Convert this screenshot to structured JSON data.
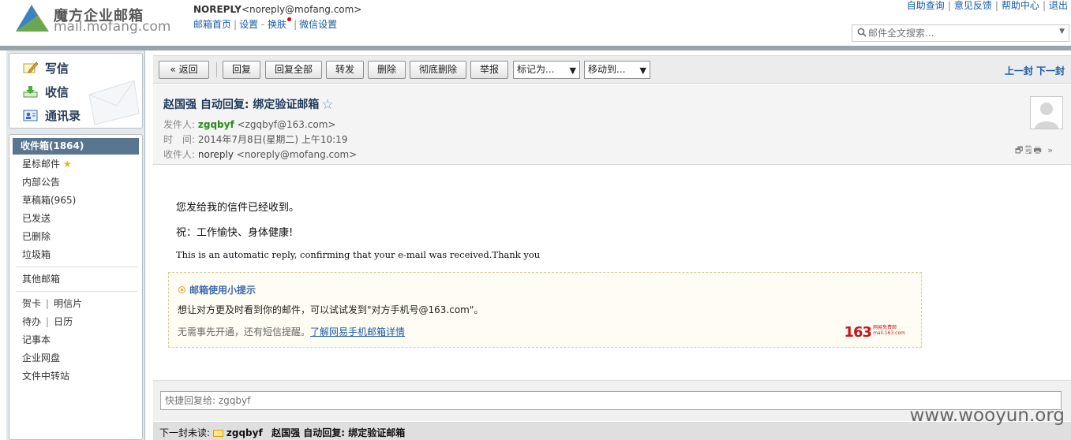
{
  "header": {
    "logo_title": "魔方企业邮箱",
    "logo_domain": "mail.mofang.com",
    "user_name": "NOREPLY",
    "user_email": "<noreply@mofang.com>",
    "links": {
      "home": "邮箱首页",
      "settings": "设置",
      "skin": "换肤",
      "wechat": "微信设置"
    },
    "top_links": [
      "自助查询",
      "意见反馈",
      "帮助中心",
      "退出"
    ],
    "search_placeholder": "邮件全文搜索..."
  },
  "sidebar": {
    "quick": {
      "compose": "写信",
      "inbox": "收信",
      "contacts": "通讯录"
    },
    "folders": {
      "inbox": "收件箱(1864)",
      "starred": "星标邮件",
      "notice": "内部公告",
      "drafts": "草稿箱(965)",
      "sent": "已发送",
      "deleted": "已删除",
      "spam": "垃圾箱",
      "other": "其他邮箱",
      "card": "贺卡",
      "postcard": "明信片",
      "todo": "待办",
      "calendar": "日历",
      "notepad": "记事本",
      "netdisk": "企业网盘",
      "transfer": "文件中转站"
    }
  },
  "toolbar": {
    "back": "« 返回",
    "reply": "回复",
    "reply_all": "回复全部",
    "forward": "转发",
    "delete": "删除",
    "delete_permanent": "彻底删除",
    "report": "举报",
    "mark_as": "标记为...",
    "move_to": "移动到...",
    "prev_next": "上一封 下一封"
  },
  "mail": {
    "subject": "赵国强 自动回复: 绑定验证邮箱",
    "from_label": "发件人:",
    "from_name": "zgqbyf",
    "from_email": "<zgqbyf@163.com>",
    "time_label": "时　间:",
    "time_value": "2014年7月8日(星期二) 上午10:19",
    "to_label": "收件人:",
    "to_name": "noreply",
    "to_email": "<noreply@mofang.com>",
    "head_icons": "🗗🗒🖶 »"
  },
  "body": {
    "line1": "您发给我的信件已经收到。",
    "line2": "祝：工作愉快、身体健康!",
    "line3": "This is an automatic reply, confirming that your e-mail was received.Thank you"
  },
  "tip": {
    "title": "邮箱使用小提示",
    "line1": "想让对方更及时看到你的邮件，可以试试发到\"对方手机号@163.com\"。",
    "line2": "无需事先开通，还有短信提醒。",
    "link": "了解网易手机邮箱详情",
    "logo_number": "163",
    "logo_text1": "网易免费邮",
    "logo_text2": "mail.163.com"
  },
  "reply": {
    "placeholder": "快捷回复给: zgqbyf"
  },
  "next_unread": {
    "label": "下一封未读:",
    "sender": "zgqbyf",
    "subject": "赵国强 自动回复: 绑定验证邮箱"
  },
  "watermark": "www.wooyun.org",
  "colors": {
    "accent_blue": "#1a5ca8",
    "active_folder": "#5a7590",
    "sender_green": "#2b8a1a",
    "logo_red": "#c8161d"
  }
}
